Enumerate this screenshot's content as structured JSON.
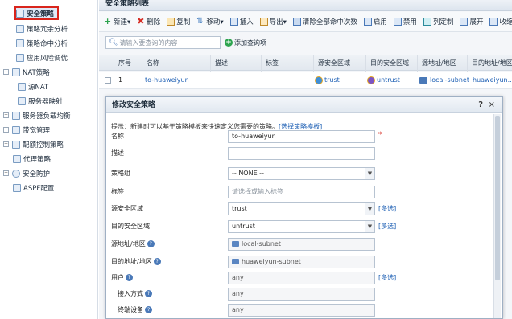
{
  "sidebar": {
    "items": [
      {
        "label": "安全策略",
        "indent": 1,
        "selected": true
      },
      {
        "label": "策略冗余分析",
        "indent": 1
      },
      {
        "label": "策略命中分析",
        "indent": 1
      },
      {
        "label": "应用风险调优",
        "indent": 1
      },
      {
        "label": "NAT策略",
        "indent": 0,
        "toggle": "−"
      },
      {
        "label": "源NAT",
        "indent": 1
      },
      {
        "label": "服务器映射",
        "indent": 1
      },
      {
        "label": "服务器负载均衡",
        "indent": 0,
        "toggle": "+"
      },
      {
        "label": "带宽管理",
        "indent": 0,
        "toggle": "+"
      },
      {
        "label": "配额控制策略",
        "indent": 0,
        "toggle": "+"
      },
      {
        "label": "代理策略",
        "indent": 0
      },
      {
        "label": "安全防护",
        "indent": 0,
        "toggle": "+"
      },
      {
        "label": "ASPF配置",
        "indent": 0
      }
    ]
  },
  "panel": {
    "title": "安全策略列表"
  },
  "toolbar": {
    "new": "新建▾",
    "delete": "删除",
    "copy": "复制",
    "move": "移动▾",
    "insert": "插入",
    "export": "导出▾",
    "clear_hits": "清除全部命中次数",
    "enable": "启用",
    "disable": "禁用",
    "columns": "列定制",
    "expand": "展开",
    "collapse": "收缩"
  },
  "search": {
    "placeholder": "请输入要查询的内容",
    "add_query": "添加查询项"
  },
  "grid": {
    "headers": [
      "序号",
      "名称",
      "描述",
      "标签",
      "源安全区域",
      "目的安全区域",
      "源地址/地区",
      "目的地址/地区"
    ],
    "row": {
      "index": "1",
      "name": "to-huaweiyun",
      "src_zone": "trust",
      "dst_zone": "untrust",
      "src_addr": "local-subnet",
      "dst_addr": "huaweiyun..."
    }
  },
  "dialog": {
    "title": "修改安全策略",
    "help": "?",
    "close": "×",
    "hint_prefix": "提示：新建时可以基于策略模板来快速定义您需要的策略。",
    "hint_link": "[选择策略模板]",
    "multi_label": "[多选]",
    "fields": {
      "name_label": "名称",
      "name_value": "to-huaweiyun",
      "desc_label": "描述",
      "group_label": "策略组",
      "group_value": "-- NONE --",
      "tag_label": "标签",
      "tag_placeholder": "请选择或输入标签",
      "src_zone_label": "源安全区域",
      "src_zone_value": "trust",
      "dst_zone_label": "目的安全区域",
      "dst_zone_value": "untrust",
      "src_addr_label": "源地址/地区",
      "src_addr_value": "local-subnet",
      "dst_addr_label": "目的地址/地区",
      "dst_addr_value": "huaweiyun-subnet",
      "user_label": "用户",
      "user_value": "any",
      "access_label": "接入方式",
      "access_value": "any",
      "terminal_label": "终端设备",
      "terminal_value": "any"
    }
  }
}
